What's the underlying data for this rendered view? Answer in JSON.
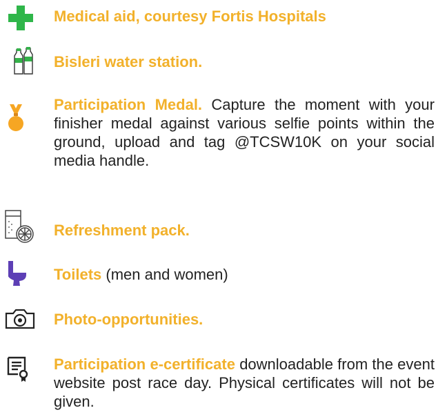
{
  "colors": {
    "highlight": "#f2b12b",
    "body_text": "#222222",
    "medical_green": "#2fb64a",
    "bottle_green": "#34b24a",
    "medal_orange": "#f6a623",
    "toilet_purple": "#5d3fb5"
  },
  "items": [
    {
      "icon": "medical-cross-icon",
      "title": "Medical aid, courtesy Fortis Hospitals",
      "body": ""
    },
    {
      "icon": "water-bottles-icon",
      "title": "Bisleri water station.",
      "body": ""
    },
    {
      "icon": "medal-icon",
      "title": "Participation Medal.",
      "body": "Capture the moment with your finisher medal against various selfie points within the ground, upload and tag @TCSW10K on your social media handle."
    },
    {
      "icon": "refreshment-icon",
      "title": "Refreshment pack.",
      "body": ""
    },
    {
      "icon": "toilet-icon",
      "title": "Toilets",
      "body": "(men and women)"
    },
    {
      "icon": "camera-icon",
      "title": "Photo-opportunities.",
      "body": ""
    },
    {
      "icon": "certificate-icon",
      "title": "Participation e-certificate",
      "body": "downloadable from the event website post race day. Physical certificates will not be given."
    }
  ]
}
